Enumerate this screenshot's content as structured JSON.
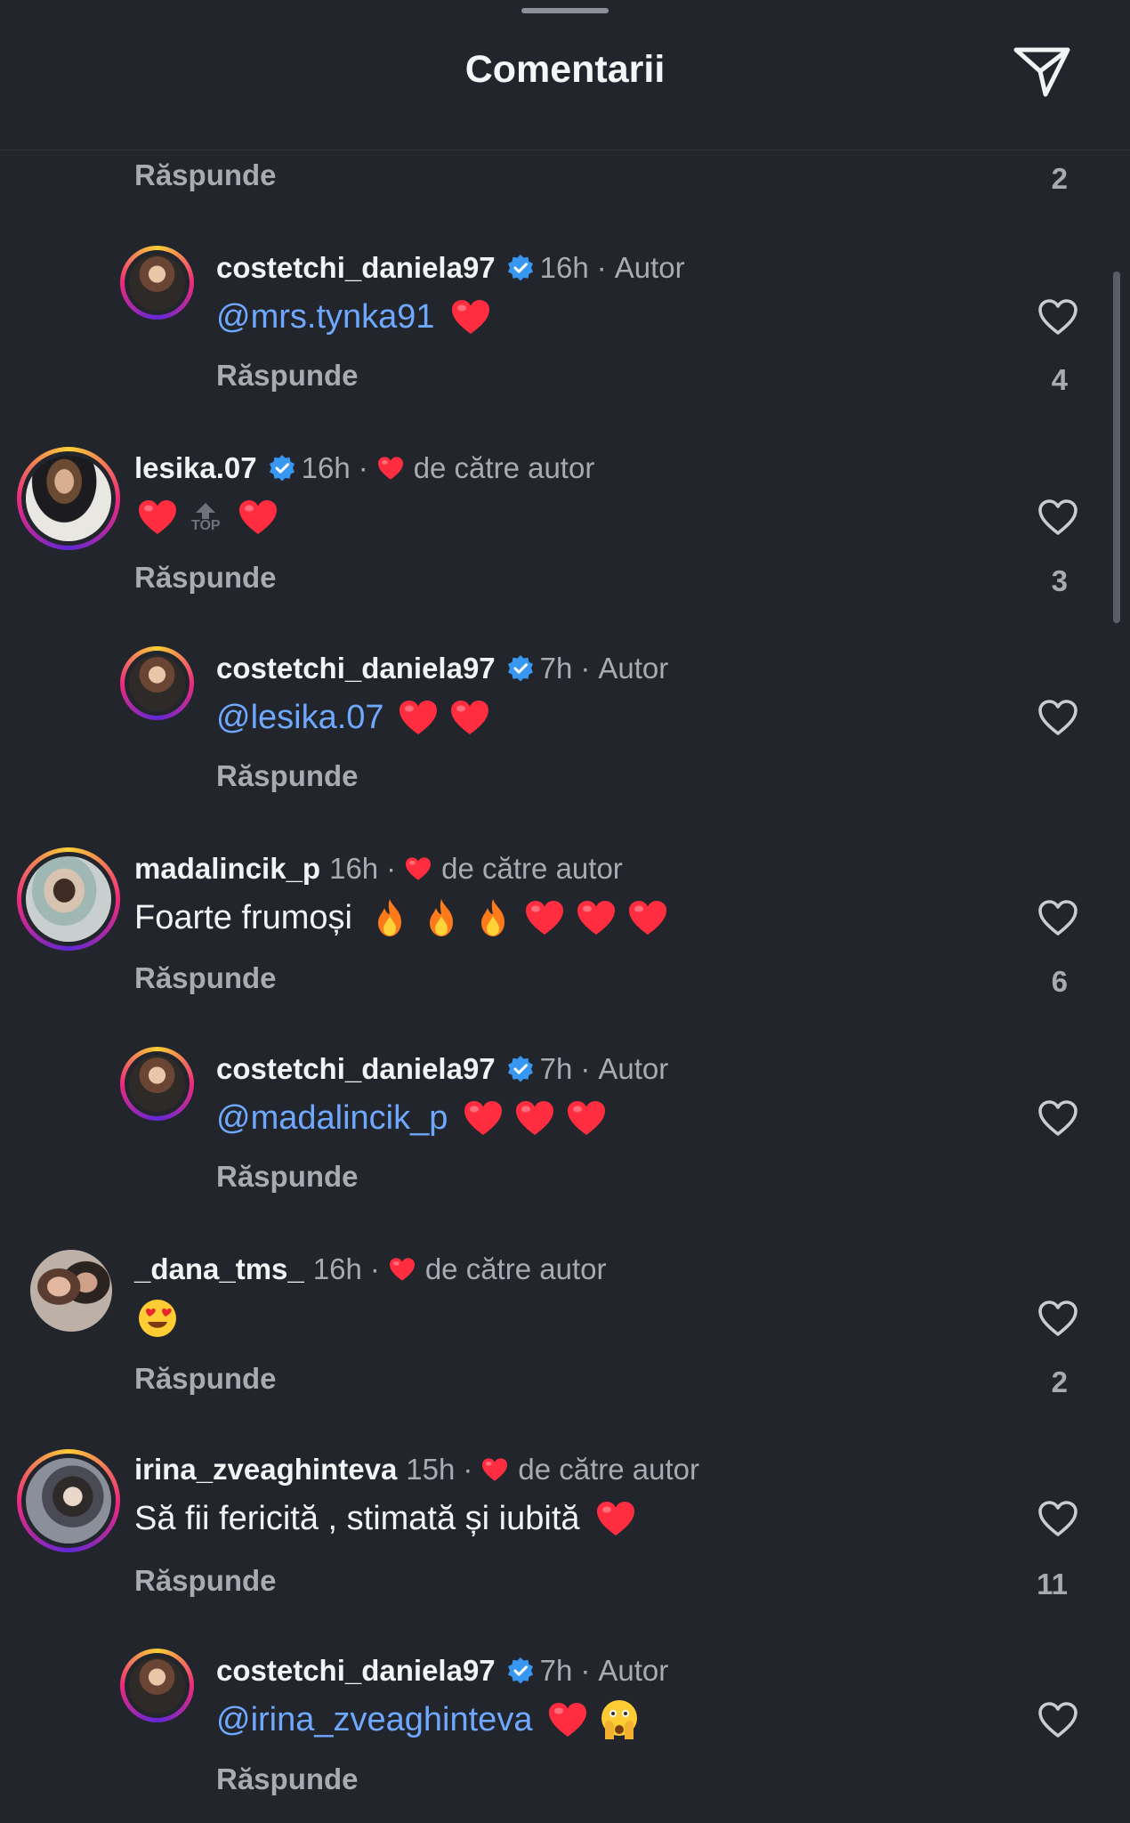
{
  "header": {
    "title": "Comentarii"
  },
  "top_partial": {
    "reply_label": "Răspunde",
    "like_count": "2"
  },
  "comments": [
    {
      "username": "costetchi_daniela97",
      "time": "16h",
      "tag": "Autor",
      "mention": "@mrs.tynka91",
      "text": "",
      "reply_label": "Răspunde",
      "like_count": "4"
    },
    {
      "username": "lesika.07",
      "time": "16h",
      "tag": "de către autor",
      "top_label": "TOP",
      "reply_label": "Răspunde",
      "like_count": "3"
    },
    {
      "username": "costetchi_daniela97",
      "time": "7h",
      "tag": "Autor",
      "mention": "@lesika.07",
      "reply_label": "Răspunde"
    },
    {
      "username": "madalincik_p",
      "time": "16h",
      "tag": "de către autor",
      "text": "Foarte frumoși",
      "reply_label": "Răspunde",
      "like_count": "6"
    },
    {
      "username": "costetchi_daniela97",
      "time": "7h",
      "tag": "Autor",
      "mention": "@madalincik_p",
      "reply_label": "Răspunde"
    },
    {
      "username": "_dana_tms_",
      "time": "16h",
      "tag": "de către autor",
      "reply_label": "Răspunde",
      "like_count": "2"
    },
    {
      "username": "irina_zveaghinteva",
      "time": "15h",
      "tag": "de către autor",
      "text": "Să fii fericită , stimată și iubită",
      "reply_label": "Răspunde",
      "like_count": "11"
    },
    {
      "username": "costetchi_daniela97",
      "time": "7h",
      "tag": "Autor",
      "mention": "@irina_zveaghinteva",
      "reply_label": "Răspunde"
    }
  ],
  "icons": {
    "send": "send-icon",
    "like": "heart-outline-icon",
    "liked_by_author": "red-heart-icon",
    "verified": "verified-badge-icon",
    "emoji_heart": "red-heart-emoji",
    "emoji_fire": "fire-emoji",
    "emoji_heart_eyes": "heart-eyes-emoji",
    "emoji_peek": "face-with-open-eyes-and-hand-over-mouth-emoji"
  },
  "colors": {
    "background": "#22252c",
    "mention": "#6fa8ff",
    "verified": "#3897f0",
    "like_red": "#ff2d3f",
    "muted": "#a8abb2"
  }
}
